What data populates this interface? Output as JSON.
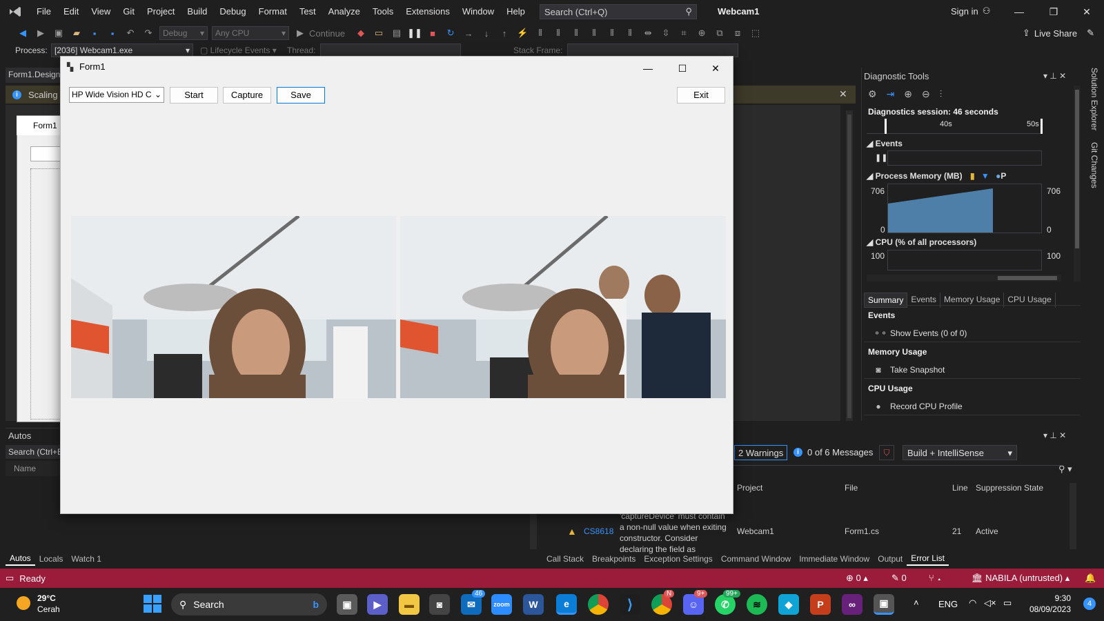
{
  "vs": {
    "menu": [
      "File",
      "Edit",
      "View",
      "Git",
      "Project",
      "Build",
      "Debug",
      "Format",
      "Test",
      "Analyze",
      "Tools",
      "Extensions",
      "Window",
      "Help"
    ],
    "search_placeholder": "Search (Ctrl+Q)",
    "solution_title": "Webcam1",
    "sign_in": "Sign in",
    "live_share": "Live Share",
    "toolbar": {
      "config": "Debug",
      "platform": "Any CPU",
      "continue": "Continue"
    },
    "process": {
      "label": "Process:",
      "value": "[2036] Webcam1.exe",
      "lifecycle": "Lifecycle Events",
      "thread": "Thread:",
      "stack_frame": "Stack Frame:"
    },
    "designer_tab": "Form1.Design",
    "infobar_text": "Scaling c",
    "design_form_title": "Form1"
  },
  "form1": {
    "title": "Form1",
    "camera_select": "HP Wide Vision HD C",
    "buttons": {
      "start": "Start",
      "capture": "Capture",
      "save": "Save",
      "exit": "Exit"
    }
  },
  "autos": {
    "title": "Autos",
    "search": "Search (Ctrl+E",
    "col_name": "Name",
    "tabs": [
      "Autos",
      "Locals",
      "Watch 1"
    ]
  },
  "errlist": {
    "warnings": "2 Warnings",
    "messages": "0 of 6 Messages",
    "build_filter": "Build + IntelliSense",
    "headers": {
      "project": "Project",
      "file": "File",
      "line": "Line",
      "suppression": "Suppression State"
    },
    "row": {
      "code": "CS8618",
      "desc_lines": [
        "'captureDevice' must contain",
        "a non-null value when exiting",
        "constructor. Consider",
        "declaring the field as"
      ],
      "project": "Webcam1",
      "file": "Form1.cs",
      "line": "21",
      "state": "Active"
    },
    "tabs": [
      "Call Stack",
      "Breakpoints",
      "Exception Settings",
      "Command Window",
      "Immediate Window",
      "Output",
      "Error List"
    ]
  },
  "diag": {
    "title": "Diagnostic Tools",
    "session": "Diagnostics session: 46 seconds",
    "ruler": [
      "40s",
      "50s"
    ],
    "events_label": "Events",
    "memory_label": "Process Memory (MB)",
    "memory_legend": "P",
    "memory_max": "706",
    "memory_min": "0",
    "cpu_label": "CPU (% of all processors)",
    "cpu_max": "100",
    "tabs": [
      "Summary",
      "Events",
      "Memory Usage",
      "CPU Usage"
    ],
    "sections": {
      "events": "Events",
      "events_link": "Show Events (0 of 0)",
      "memory": "Memory Usage",
      "memory_link": "Take Snapshot",
      "cpu": "CPU Usage",
      "cpu_link": "Record CPU Profile"
    },
    "side_tabs": [
      "Solution Explorer",
      "Git Changes"
    ]
  },
  "statusbar": {
    "ready": "Ready",
    "errors": "0",
    "edits": "0",
    "user": "NABILA (untrusted)"
  },
  "taskbar": {
    "weather_temp": "29°C",
    "weather_desc": "Cerah",
    "search": "Search",
    "badges": {
      "mail": "46",
      "chrome": "N",
      "discord": "9+",
      "whatsapp": "99+"
    },
    "lang": "ENG",
    "time": "9:30",
    "date": "08/09/2023",
    "notif": "4"
  },
  "colors": {
    "accent": "#3794ff",
    "status": "#9b1b3a",
    "warning": "#e8b53c"
  }
}
